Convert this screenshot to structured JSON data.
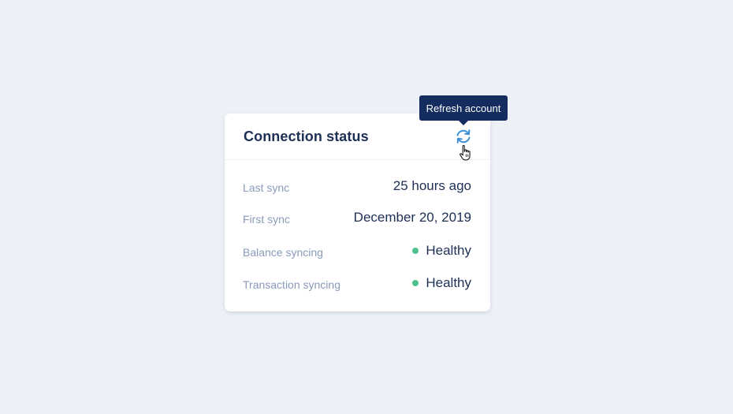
{
  "card": {
    "title": "Connection status",
    "refresh_icon": "refresh-icon"
  },
  "tooltip": {
    "text": "Refresh account"
  },
  "rows": [
    {
      "label": "Last sync",
      "value": "25 hours ago"
    },
    {
      "label": "First sync",
      "value": "December 20, 2019"
    },
    {
      "label": "Balance syncing",
      "value": "Healthy",
      "status": "healthy"
    },
    {
      "label": "Transaction syncing",
      "value": "Healthy",
      "status": "healthy"
    }
  ],
  "colors": {
    "background": "#edf1f7",
    "title": "#1d2f55",
    "label": "#8a9abb",
    "accent": "#3a8fd8",
    "healthy": "#4fc18e",
    "tooltip": "#142c5e"
  },
  "cursor": "hand-pointer-icon"
}
